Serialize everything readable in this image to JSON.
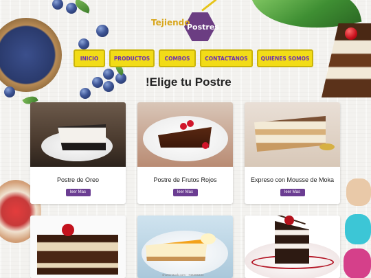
{
  "brand": {
    "line1": "Tejiendo",
    "line2": "Postres"
  },
  "nav": [
    {
      "label": "INICIO"
    },
    {
      "label": "PRODUCTOS"
    },
    {
      "label": "COMBOS"
    },
    {
      "label": "CONTACTANOS"
    },
    {
      "label": "QUIENES SOMOS"
    }
  ],
  "heading": "!Elige tu Postre",
  "products": [
    {
      "title": "Postre de Oreo",
      "button": "leer Mas"
    },
    {
      "title": "Postre de Frutos Rojos",
      "button": "leer Mas"
    },
    {
      "title": "Expreso con Mousse de Moka",
      "button": "leer Mas"
    }
  ],
  "watermark": "shutterstock.com · 746396344",
  "colors": {
    "nav_bg": "#f2dc17",
    "nav_text": "#6b2cb3",
    "button_bg": "#6b3d92",
    "logo_hex": "#6b3d82",
    "logo_gold": "#d8a61c"
  },
  "icons": [
    "blueberry-bowl",
    "leaf",
    "cherry",
    "macaron"
  ]
}
